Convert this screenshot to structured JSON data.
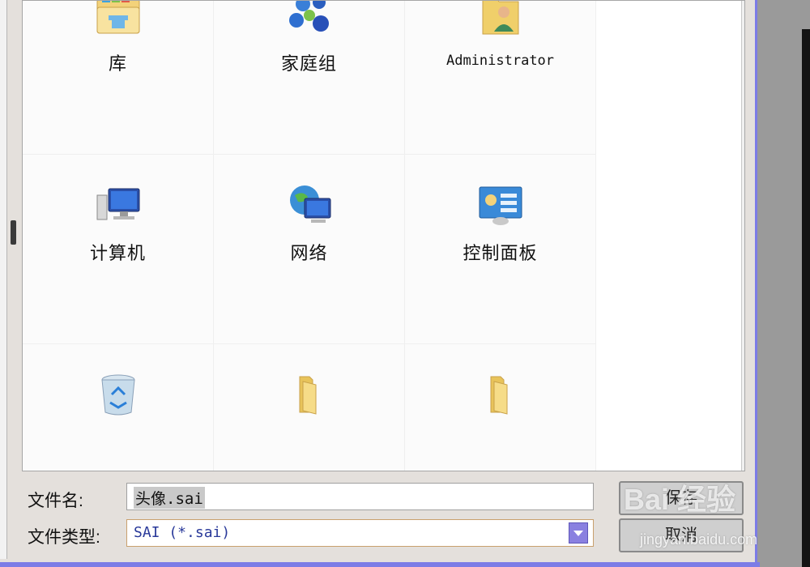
{
  "items": [
    {
      "label": "库",
      "icon": "library-icon"
    },
    {
      "label": "家庭组",
      "icon": "homegroup-icon"
    },
    {
      "label": "Administrator",
      "icon": "user-folder-icon"
    },
    {
      "label": "计算机",
      "icon": "computer-icon"
    },
    {
      "label": "网络",
      "icon": "network-icon"
    },
    {
      "label": "控制面板",
      "icon": "control-panel-icon"
    },
    {
      "label": "",
      "icon": "recycle-bin-icon"
    },
    {
      "label": "",
      "icon": "folder-icon"
    },
    {
      "label": "",
      "icon": "folder-icon"
    }
  ],
  "form": {
    "filename_label": "文件名:",
    "filename_value": "头像.sai",
    "filetype_label": "文件类型:",
    "filetype_value": "SAI (*.sai)"
  },
  "buttons": {
    "save": "保存",
    "cancel": "取消"
  },
  "watermark": {
    "brand": "Bai 经验",
    "url": "jingyan.baidu.com"
  }
}
